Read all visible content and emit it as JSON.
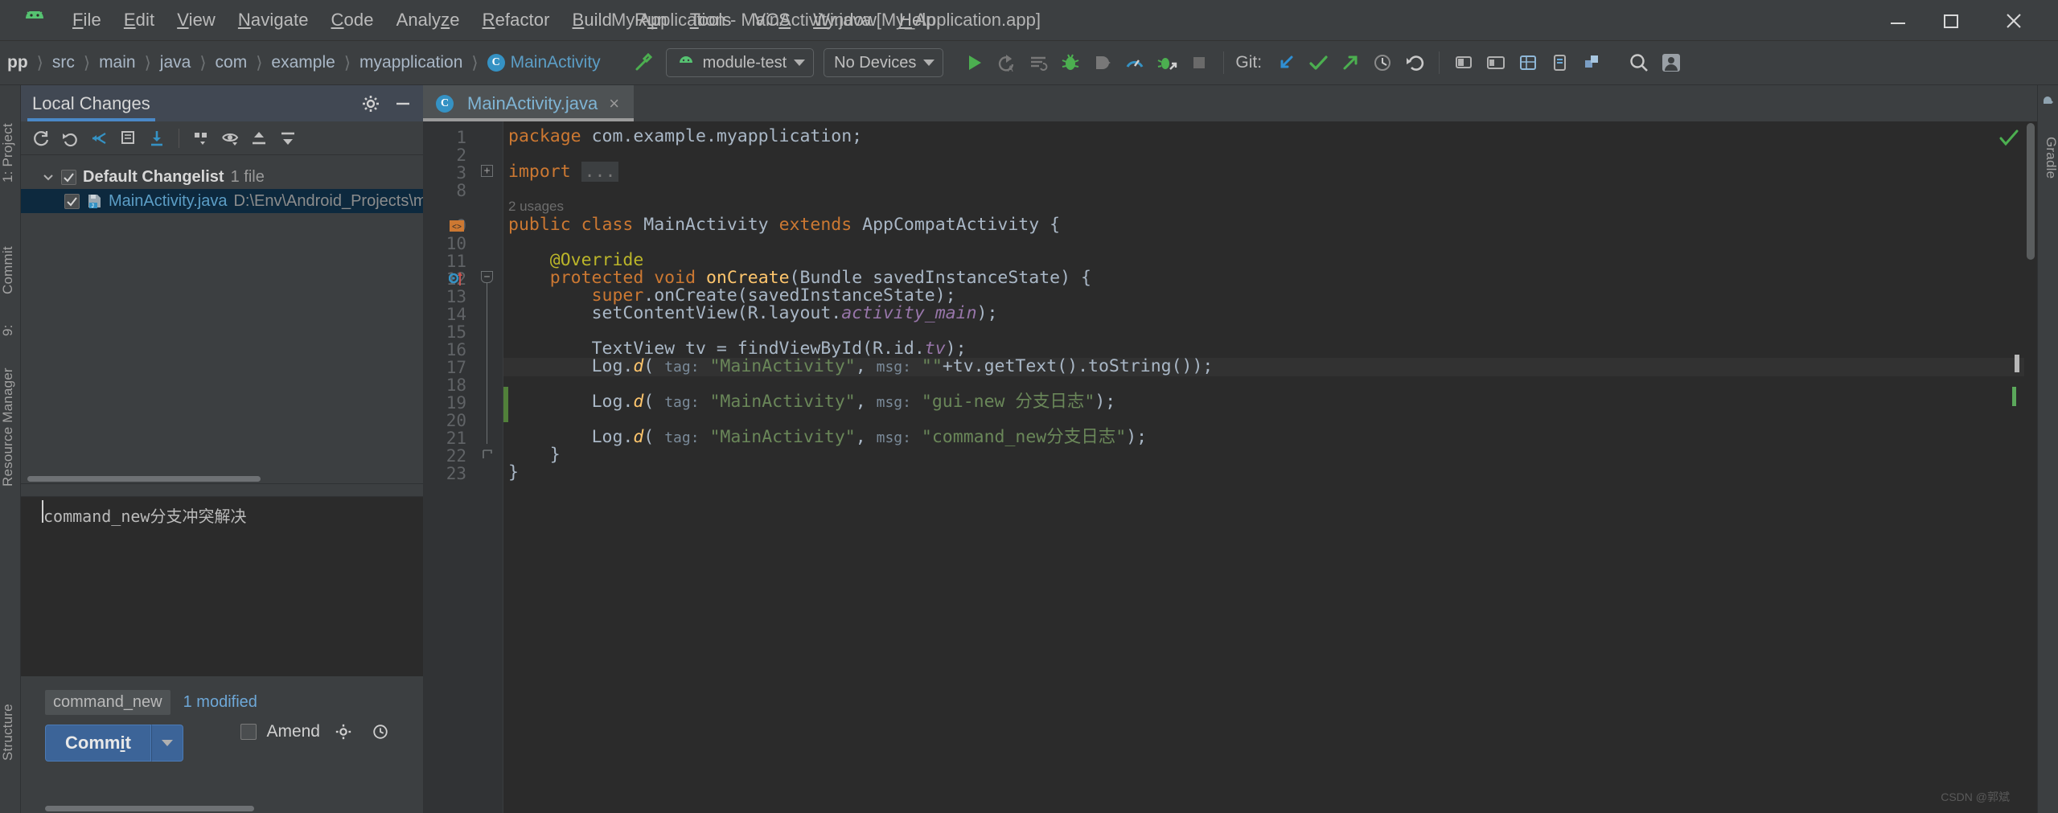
{
  "window": {
    "title": "My Application - MainActivity.java [My_Application.app]",
    "app_icon": "android-robot-icon",
    "minimize": "minimize-icon",
    "maximize": "maximize-icon",
    "close": "close-icon"
  },
  "menu": [
    {
      "label": "File",
      "mnemonic": "F"
    },
    {
      "label": "Edit",
      "mnemonic": "E"
    },
    {
      "label": "View",
      "mnemonic": "V"
    },
    {
      "label": "Navigate",
      "mnemonic": "N"
    },
    {
      "label": "Code",
      "mnemonic": "C"
    },
    {
      "label": "Analyze",
      "mnemonic": "z"
    },
    {
      "label": "Refactor",
      "mnemonic": "R"
    },
    {
      "label": "Build",
      "mnemonic": "B"
    },
    {
      "label": "Run",
      "mnemonic": "u"
    },
    {
      "label": "Tools",
      "mnemonic": "T"
    },
    {
      "label": "VCS",
      "mnemonic": "S"
    },
    {
      "label": "Window",
      "mnemonic": "W"
    },
    {
      "label": "Help",
      "mnemonic": "H"
    }
  ],
  "breadcrumbs": [
    {
      "label": "pp",
      "style": "bold"
    },
    {
      "label": "src",
      "style": "normal"
    },
    {
      "label": "main",
      "style": "normal"
    },
    {
      "label": "java",
      "style": "normal"
    },
    {
      "label": "com",
      "style": "normal"
    },
    {
      "label": "example",
      "style": "normal"
    },
    {
      "label": "myapplication",
      "style": "normal"
    },
    {
      "label": "MainActivity",
      "style": "class",
      "badge": "C"
    }
  ],
  "toolbar": {
    "build_icon": "hammer-build-icon",
    "run_config": {
      "label": "module-test",
      "icon": "android-module-icon"
    },
    "device": {
      "label": "No Devices"
    },
    "run": "run-icon",
    "apply_changes": "apply-changes-icon",
    "apply_code_changes": "apply-code-changes-icon",
    "debug": "debug-icon",
    "attach_debugger": "attach-debugger-icon",
    "profiler": "profiler-icon",
    "debug_attach": "run-debug-attach-icon",
    "stop": "stop-icon",
    "git_label": "Git:",
    "git_update": "git-update-icon",
    "git_commit": "git-commit-icon",
    "git_push": "git-push-icon",
    "git_history": "git-history-icon",
    "git_rollback": "git-rollback-icon",
    "make_project": "make-project-icon",
    "avd_manager": "avd-manager-icon",
    "sdk_manager": "sdk-manager-icon",
    "layout_inspector": "layout-inspector-icon",
    "device_file_explorer": "device-file-explorer-icon",
    "search": "search-icon",
    "account": "account-avatar-icon"
  },
  "left_tool_tabs": [
    {
      "label": "1: Project"
    },
    {
      "label": "Commit"
    },
    {
      "label": "9:"
    },
    {
      "label": "Resource Manager"
    },
    {
      "label": "Structure"
    }
  ],
  "right_tool_tabs": [
    {
      "label": "Gradle"
    }
  ],
  "vcs_panel": {
    "tab": "Local Changes",
    "settings_icon": "gear-icon",
    "hide_icon": "minimize-icon",
    "toolbar_icons": [
      "refresh-icon",
      "rollback-icon",
      "shelve-silently-icon",
      "show-diff-icon",
      "get-from-vcs-icon",
      "group-by-icon",
      "preview-icon",
      "expand-all-icon",
      "collapse-all-icon"
    ],
    "changelist": {
      "name": "Default Changelist",
      "count_label": "1 file",
      "checked": true,
      "expanded": true
    },
    "files": [
      {
        "name": "MainActivity.java",
        "path": "D:\\Env\\Android_Projects\\my-application",
        "checked": true,
        "selected": true,
        "icon": "java-file-icon"
      }
    ],
    "commit_message": "command_new分支冲突解决",
    "branch": "command_new",
    "modified_label": "1 modified",
    "commit_button": "Commit",
    "commit_mnemonic": "i",
    "commit_dropdown_icon": "chevron-down-icon",
    "amend_label": "Amend",
    "amend_checked": false,
    "amend_gear_icon": "gear-icon",
    "amend_history_icon": "history-icon"
  },
  "editor": {
    "tab": {
      "name": "MainActivity.java",
      "badge": "C",
      "close": "×"
    },
    "inspection_status": "ok-check-icon",
    "watermark": "CSDN @郭斌",
    "current_line": 17,
    "lines": [
      {
        "num": 1,
        "tokens": [
          {
            "t": "package ",
            "c": "kw"
          },
          {
            "t": "com.example.myapplication;",
            "c": "cls"
          }
        ],
        "indent": 0
      },
      {
        "num": 2,
        "tokens": [],
        "indent": 0
      },
      {
        "num": 3,
        "tokens": [
          {
            "t": "import ",
            "c": "kw"
          },
          {
            "t": "...",
            "c": "fold"
          }
        ],
        "indent": 0
      },
      {
        "num": 8,
        "tokens": [],
        "indent": 0
      },
      {
        "num": 9,
        "tokens": [
          {
            "t": "public ",
            "c": "kw"
          },
          {
            "t": "class ",
            "c": "kw"
          },
          {
            "t": "MainActivity ",
            "c": "cls"
          },
          {
            "t": "extends ",
            "c": "kw"
          },
          {
            "t": "AppCompatActivity {",
            "c": "cls"
          }
        ],
        "indent": 0,
        "hint": "2 usages"
      },
      {
        "num": 10,
        "tokens": [],
        "indent": 0
      },
      {
        "num": 11,
        "tokens": [
          {
            "t": "@Override",
            "c": "ann"
          }
        ],
        "indent": 1
      },
      {
        "num": 12,
        "tokens": [
          {
            "t": "protected ",
            "c": "kw"
          },
          {
            "t": "void ",
            "c": "kw"
          },
          {
            "t": "onCreate",
            "c": "meth"
          },
          {
            "t": "(Bundle savedInstanceState) {",
            "c": "cls"
          }
        ],
        "indent": 1
      },
      {
        "num": 13,
        "tokens": [
          {
            "t": "super",
            "c": "kw"
          },
          {
            "t": ".onCreate(savedInstanceState);",
            "c": "cls"
          }
        ],
        "indent": 2
      },
      {
        "num": 14,
        "tokens": [
          {
            "t": "setContentView(R.layout.",
            "c": "cls"
          },
          {
            "t": "activity_main",
            "c": "fld-ital"
          },
          {
            "t": ");",
            "c": "cls"
          }
        ],
        "indent": 2
      },
      {
        "num": 15,
        "tokens": [],
        "indent": 2
      },
      {
        "num": 16,
        "tokens": [
          {
            "t": "TextView tv = findViewById(R.id.",
            "c": "cls"
          },
          {
            "t": "tv",
            "c": "fld-ital"
          },
          {
            "t": ");",
            "c": "cls"
          }
        ],
        "indent": 2
      },
      {
        "num": 17,
        "tokens": [
          {
            "t": "Log.",
            "c": "cls"
          },
          {
            "t": "d",
            "c": "meth-ital"
          },
          {
            "t": "( ",
            "c": "cls"
          },
          {
            "t": "tag:",
            "c": "hint"
          },
          {
            "t": " \"MainActivity\"",
            "c": "str"
          },
          {
            "t": ", ",
            "c": "cls"
          },
          {
            "t": "msg:",
            "c": "hint"
          },
          {
            "t": " \"\"",
            "c": "str"
          },
          {
            "t": "+tv.getText().toString());",
            "c": "cls"
          }
        ],
        "indent": 2
      },
      {
        "num": 18,
        "tokens": [],
        "indent": 2
      },
      {
        "num": 19,
        "tokens": [
          {
            "t": "Log.",
            "c": "cls"
          },
          {
            "t": "d",
            "c": "meth-ital"
          },
          {
            "t": "( ",
            "c": "cls"
          },
          {
            "t": "tag:",
            "c": "hint"
          },
          {
            "t": " \"MainActivity\"",
            "c": "str"
          },
          {
            "t": ", ",
            "c": "cls"
          },
          {
            "t": "msg:",
            "c": "hint"
          },
          {
            "t": " \"gui-new 分支日志\"",
            "c": "str"
          },
          {
            "t": ");",
            "c": "cls"
          }
        ],
        "indent": 2
      },
      {
        "num": 20,
        "tokens": [],
        "indent": 2
      },
      {
        "num": 21,
        "tokens": [
          {
            "t": "Log.",
            "c": "cls"
          },
          {
            "t": "d",
            "c": "meth-ital"
          },
          {
            "t": "( ",
            "c": "cls"
          },
          {
            "t": "tag:",
            "c": "hint"
          },
          {
            "t": " \"MainActivity\"",
            "c": "str"
          },
          {
            "t": ", ",
            "c": "cls"
          },
          {
            "t": "msg:",
            "c": "hint"
          },
          {
            "t": " \"command_new分支日志\"",
            "c": "str"
          },
          {
            "t": ");",
            "c": "cls"
          }
        ],
        "indent": 2
      },
      {
        "num": 22,
        "tokens": [
          {
            "t": "}",
            "c": "cls"
          }
        ],
        "indent": 1
      },
      {
        "num": 23,
        "tokens": [
          {
            "t": "}",
            "c": "cls"
          }
        ],
        "indent": 0
      }
    ],
    "gutter_markers": [
      {
        "line": 9,
        "icon": "class-marker-icon"
      },
      {
        "line": 12,
        "icon": "override-method-icon"
      }
    ],
    "change_bars": [
      {
        "from_line": 19,
        "to_line": 20
      }
    ]
  },
  "colors": {
    "bg": "#2b2b2b",
    "chrome": "#3c3f41",
    "accent_blue": "#4a88c7",
    "link": "#5c9ec6",
    "keyword": "#cc7832",
    "string": "#6a8759",
    "annotation": "#bbb529",
    "field": "#9876aa",
    "method": "#ffc66d",
    "green": "#4caf50"
  }
}
